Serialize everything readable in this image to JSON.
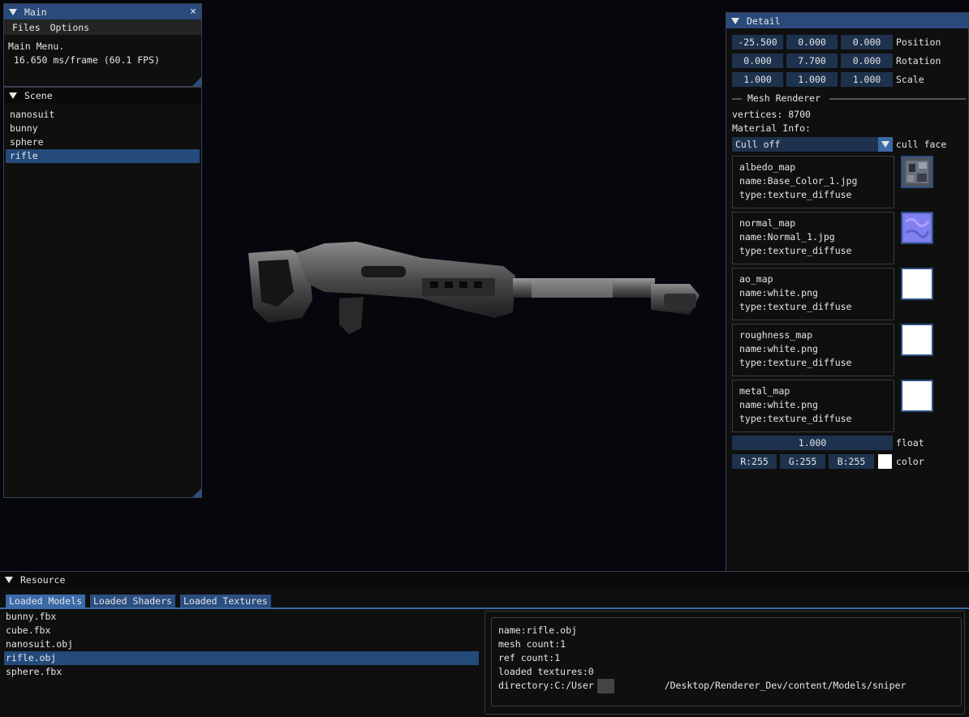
{
  "main_window": {
    "title": "Main",
    "close_icon": "×",
    "menu": [
      "Files",
      "Options"
    ],
    "line1": "Main Menu.",
    "line2": " 16.650 ms/frame (60.1 FPS)"
  },
  "scene_window": {
    "title": "Scene",
    "items": [
      "nanosuit",
      "bunny",
      "sphere",
      "rifle"
    ],
    "selected": "rifle"
  },
  "detail_window": {
    "title": "Detail",
    "transform": [
      {
        "label": "Position",
        "values": [
          "-25.500",
          "0.000",
          "0.000"
        ]
      },
      {
        "label": "Rotation",
        "values": [
          "0.000",
          "7.700",
          "0.000"
        ]
      },
      {
        "label": "Scale",
        "values": [
          "1.000",
          "1.000",
          "1.000"
        ]
      }
    ],
    "mesh_renderer_header": "Mesh Renderer",
    "vertices": "vertices: 8700",
    "material_info": "Material Info:",
    "cull_value": "Cull off",
    "cull_label": "cull face",
    "materials": [
      {
        "title": "albedo_map",
        "name": "name:Base_Color_1.jpg",
        "type": "type:texture_diffuse",
        "thumb": "albedo-texture"
      },
      {
        "title": "normal_map",
        "name": "name:Normal_1.jpg",
        "type": "type:texture_diffuse",
        "thumb": "normal-texture"
      },
      {
        "title": "ao_map",
        "name": "name:white.png",
        "type": "type:texture_diffuse",
        "thumb": "white-texture"
      },
      {
        "title": "roughness_map",
        "name": "name:white.png",
        "type": "type:texture_diffuse",
        "thumb": "white-texture"
      },
      {
        "title": "metal_map",
        "name": "name:white.png",
        "type": "type:texture_diffuse",
        "thumb": "white-texture"
      }
    ],
    "float_value": "1.000",
    "float_label": "float",
    "color": {
      "r": "R:255",
      "g": "G:255",
      "b": "B:255",
      "label": "color",
      "swatch": "#ffffff"
    }
  },
  "resource_window": {
    "title": "Resource",
    "tabs": [
      "Loaded Models",
      "Loaded Shaders",
      "Loaded Textures"
    ],
    "active_tab": "Loaded Models",
    "models": [
      "bunny.fbx",
      "cube.fbx",
      "nanosuit.obj",
      "rifle.obj",
      "sphere.fbx"
    ],
    "selected_model": "rifle.obj",
    "info": {
      "name": "name:rifle.obj",
      "mesh_count": "mesh count:1",
      "ref_count": "ref count:1",
      "loaded_textures": "loaded textures:0",
      "directory_prefix": "directory:C:/User",
      "directory_suffix": "/Desktop/Renderer_Dev/content/Models/sniper"
    }
  },
  "colors": {
    "title_active": "#294a7a",
    "field_bg": "#1e324e",
    "selection": "#234a7a",
    "viewport_bg": "#05070d"
  },
  "viewport": {
    "model": "rifle-3d-render"
  }
}
